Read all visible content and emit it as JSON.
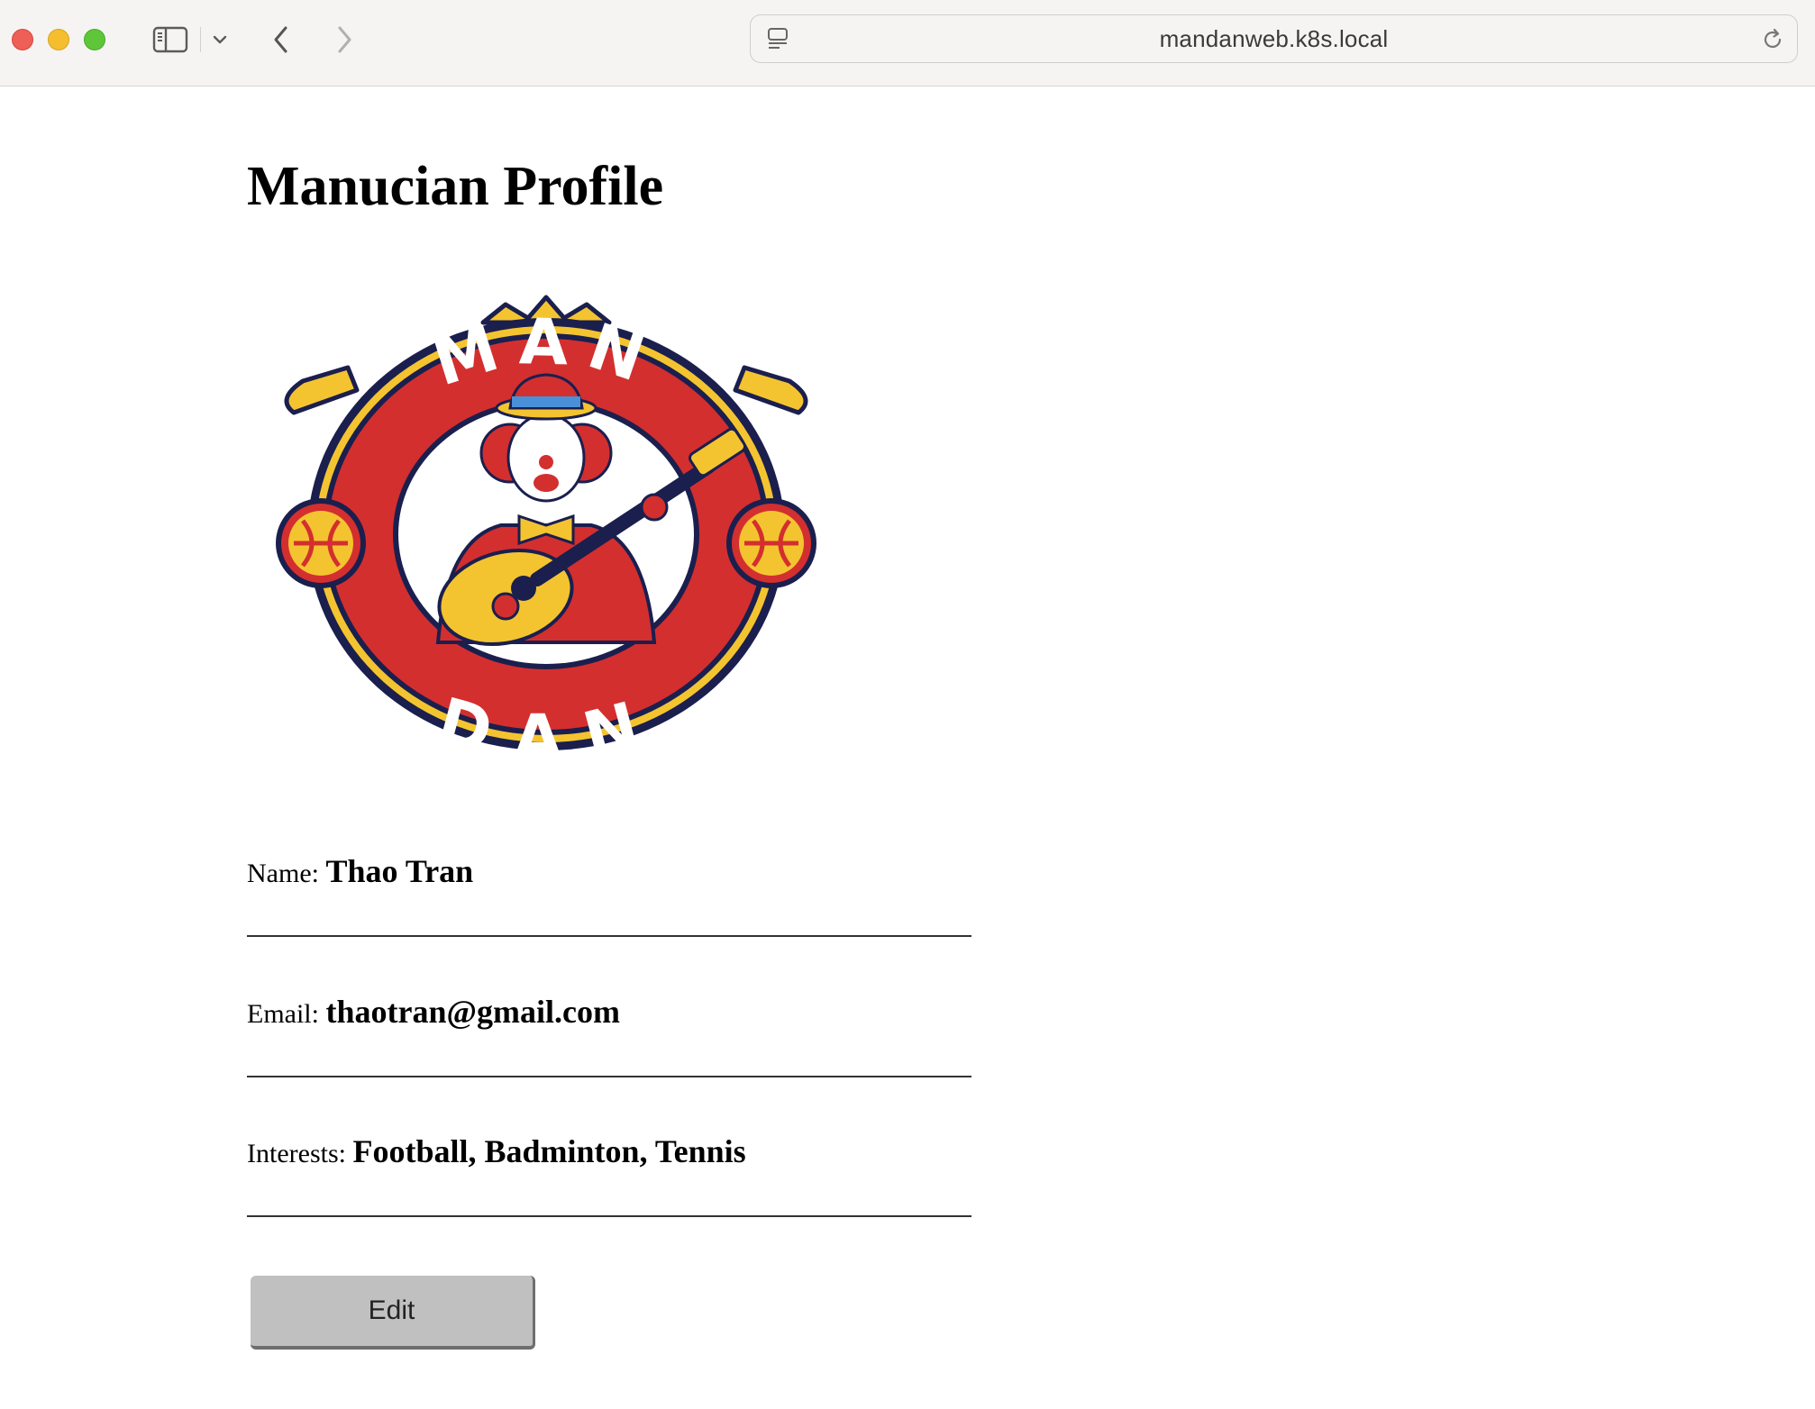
{
  "browser": {
    "url": "mandanweb.k8s.local",
    "icons": [
      "close-window",
      "minimize-window",
      "zoom-window",
      "sidebar",
      "chevron-down",
      "back",
      "forward",
      "site-info",
      "reload"
    ]
  },
  "page": {
    "title": "Manucian Profile",
    "logo": {
      "top_text": "MAN",
      "bottom_text": "DAN",
      "colors": {
        "red": "#d32f2f",
        "yellow": "#f4c430",
        "navy": "#1a1f4e"
      }
    },
    "fields": [
      {
        "label": "Name:",
        "value": "Thao Tran"
      },
      {
        "label": "Email:",
        "value": "thaotran@gmail.com"
      },
      {
        "label": "Interests:",
        "value": "Football, Badminton, Tennis"
      }
    ],
    "edit_label": "Edit"
  }
}
